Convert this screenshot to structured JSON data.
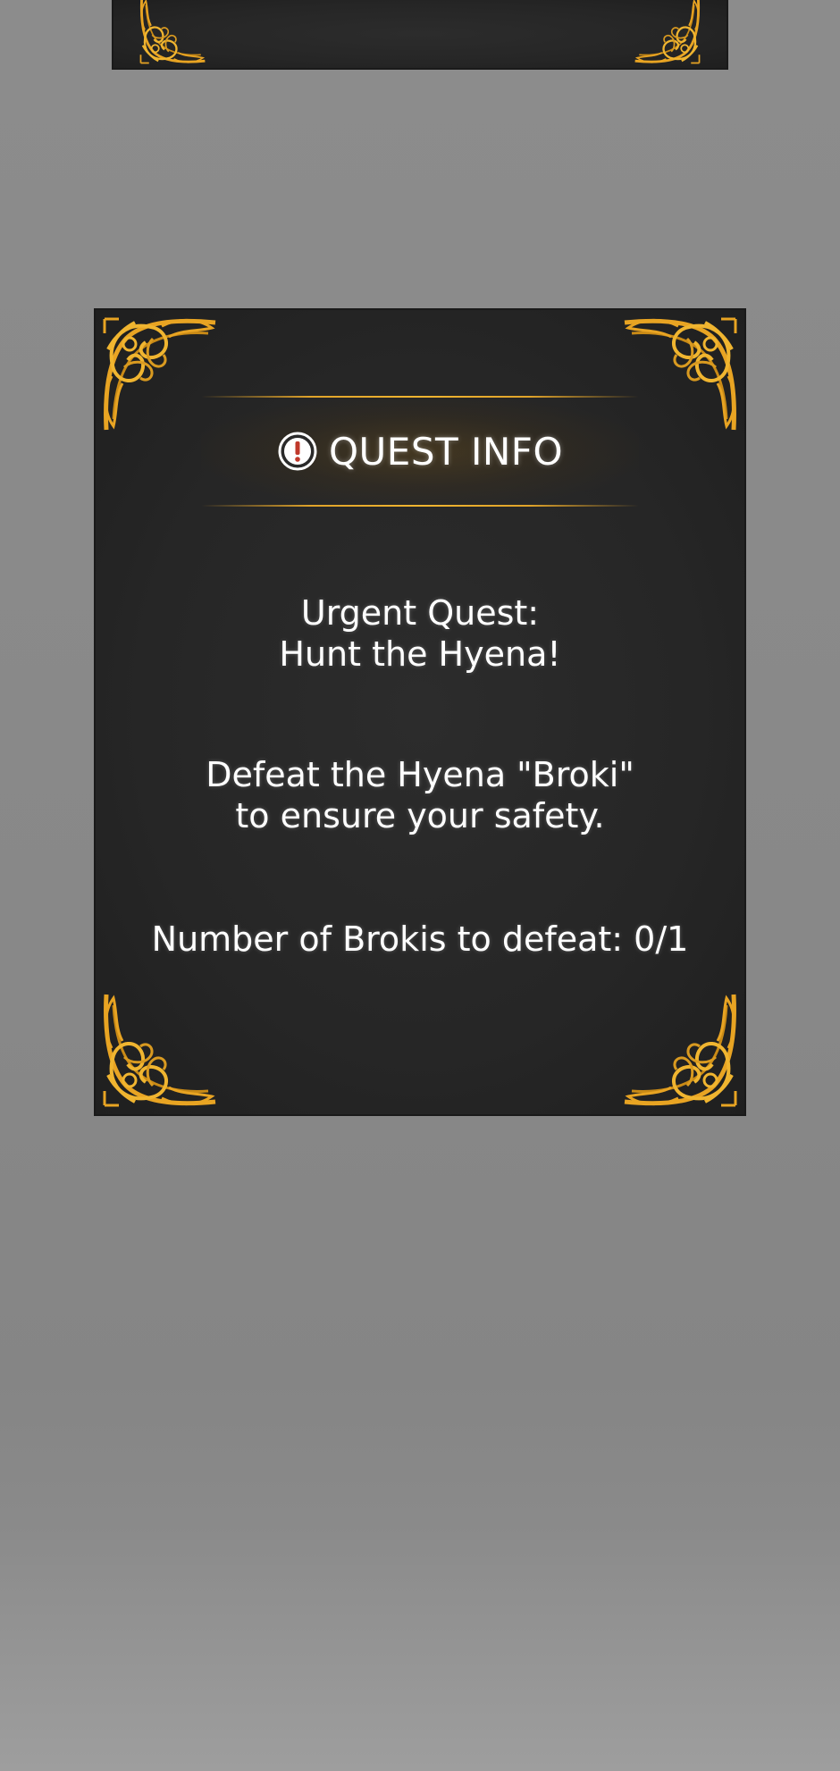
{
  "quest_panel": {
    "title": "QUEST INFO",
    "title_icon": "exclamation-circle-icon",
    "quest_label": "Urgent Quest:",
    "quest_name": "Hunt the Hyena!",
    "description_line1": "Defeat the Hyena \"Broki\"",
    "description_line2": "to ensure your safety.",
    "progress_text": "Number of Brokis to defeat: 0/1",
    "progress": {
      "current": 0,
      "total": 1
    }
  },
  "decoration": {
    "corner_ornament": "art-nouveau-corner-ornament",
    "accent_color": "#e8a423",
    "panel_color": "#262626"
  }
}
